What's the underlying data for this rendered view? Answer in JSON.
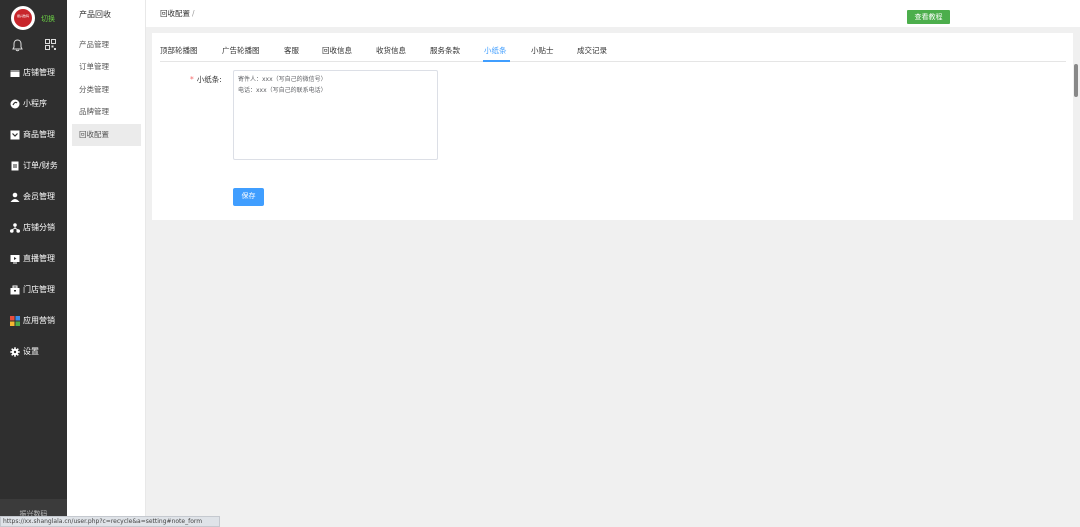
{
  "brand": {
    "logo_text": "振兴数码",
    "switch_label": "切换"
  },
  "main_nav": [
    {
      "label": "店铺管理",
      "icon": "store-icon"
    },
    {
      "label": "小程序",
      "icon": "miniprogram-icon"
    },
    {
      "label": "商品管理",
      "icon": "goods-icon"
    },
    {
      "label": "订单/财务",
      "icon": "order-icon"
    },
    {
      "label": "会员管理",
      "icon": "member-icon"
    },
    {
      "label": "店铺分销",
      "icon": "distribution-icon"
    },
    {
      "label": "直播管理",
      "icon": "live-icon"
    },
    {
      "label": "门店管理",
      "icon": "shop-icon"
    },
    {
      "label": "应用营销",
      "icon": "apps-icon"
    },
    {
      "label": "设置",
      "icon": "gear-icon"
    }
  ],
  "sidebar_footer": "振兴数码",
  "sub_nav": {
    "title": "产品回收",
    "items": [
      {
        "label": "产品管理"
      },
      {
        "label": "订单管理"
      },
      {
        "label": "分类管理"
      },
      {
        "label": "品牌管理"
      },
      {
        "label": "回收配置"
      }
    ],
    "active_index": 4
  },
  "header": {
    "breadcrumb": "回收配置",
    "breadcrumb_sep": "/",
    "tutorial_label": "查看教程"
  },
  "tabs": [
    {
      "label": "顶部轮播图"
    },
    {
      "label": "广告轮播图"
    },
    {
      "label": "客服"
    },
    {
      "label": "回收信息"
    },
    {
      "label": "收货信息"
    },
    {
      "label": "服务条款"
    },
    {
      "label": "小纸条"
    },
    {
      "label": "小贴士"
    },
    {
      "label": "成交记录"
    }
  ],
  "active_tab": "小纸条",
  "form": {
    "required_mark": "*",
    "label": "小纸条:",
    "note_value": "寄件人：xxx（写自己的微信号）\n电话：xxx（写自己的联系电话）",
    "save_label": "保存"
  },
  "status_url": "https://xx.shanglala.cn/user.php?c=recycle&a=setting#note_form",
  "colors": {
    "sidebar_bg": "#2f2f2f",
    "accent": "#409eff",
    "tutorial_green": "#4cae4c",
    "required_red": "#f56c6c",
    "switch_green": "#6bd045"
  }
}
